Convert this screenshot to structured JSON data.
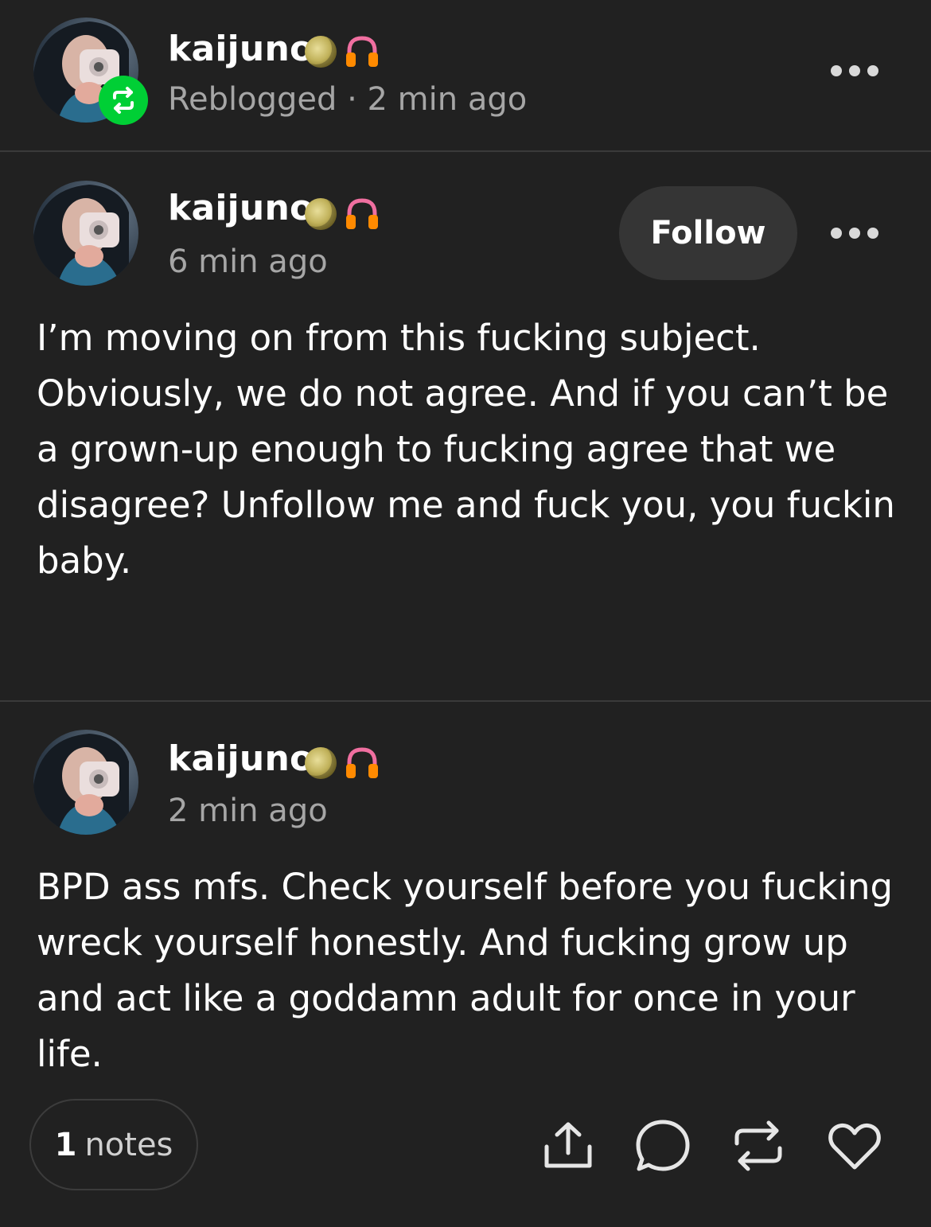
{
  "reblog_header": {
    "username": "kaijuno",
    "status": "Reblogged · 2 min ago",
    "badges": [
      "moon-icon",
      "headphones-icon"
    ]
  },
  "original_post": {
    "username": "kaijuno",
    "time": "6 min ago",
    "follow_label": "Follow",
    "body": "I’m moving on from this fucking subject. Obviously, we do not agree. And if you can’t be a grown-up enough to fucking agree that we disagree? Unfollow me and fuck you, you fuckin baby."
  },
  "reblog_post": {
    "username": "kaijuno",
    "time": "2 min ago",
    "body": "BPD ass mfs. Check yourself before you fucking wreck yourself honestly. And fucking grow up and act like a goddamn adult for once in your life."
  },
  "footer": {
    "notes_count": "1",
    "notes_label": "notes",
    "actions": [
      "share-icon",
      "comment-icon",
      "reblog-icon",
      "heart-icon"
    ]
  },
  "colors": {
    "background": "#212121",
    "reblog_green": "#00cf35",
    "muted_text": "#a6a6a6"
  }
}
